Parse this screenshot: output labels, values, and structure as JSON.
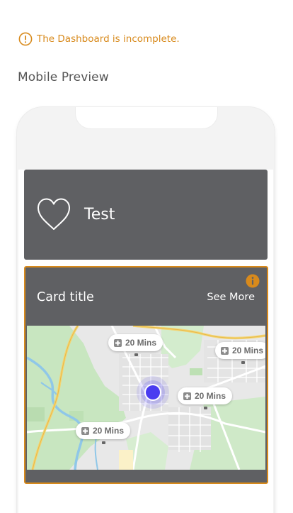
{
  "warning": {
    "text": "The Dashboard is incomplete.",
    "color": "#d88a1c",
    "icon": "alert-circle-icon"
  },
  "section": {
    "title": "Mobile Preview"
  },
  "favorite_card": {
    "label": "Test",
    "icon": "heart-outline-icon",
    "background": "#5f6063"
  },
  "map_card": {
    "title": "Card title",
    "see_more": "See More",
    "border_color": "#d88a1c",
    "info_icon": "info-icon",
    "markers": [
      {
        "label": "20 Mins",
        "icon": "hospital-icon"
      },
      {
        "label": "20 Mins",
        "icon": "hospital-icon"
      },
      {
        "label": "20 Mins",
        "icon": "hospital-icon"
      },
      {
        "label": "20 Mins",
        "icon": "hospital-icon"
      }
    ],
    "current_location_color": "#4a3cf0"
  }
}
